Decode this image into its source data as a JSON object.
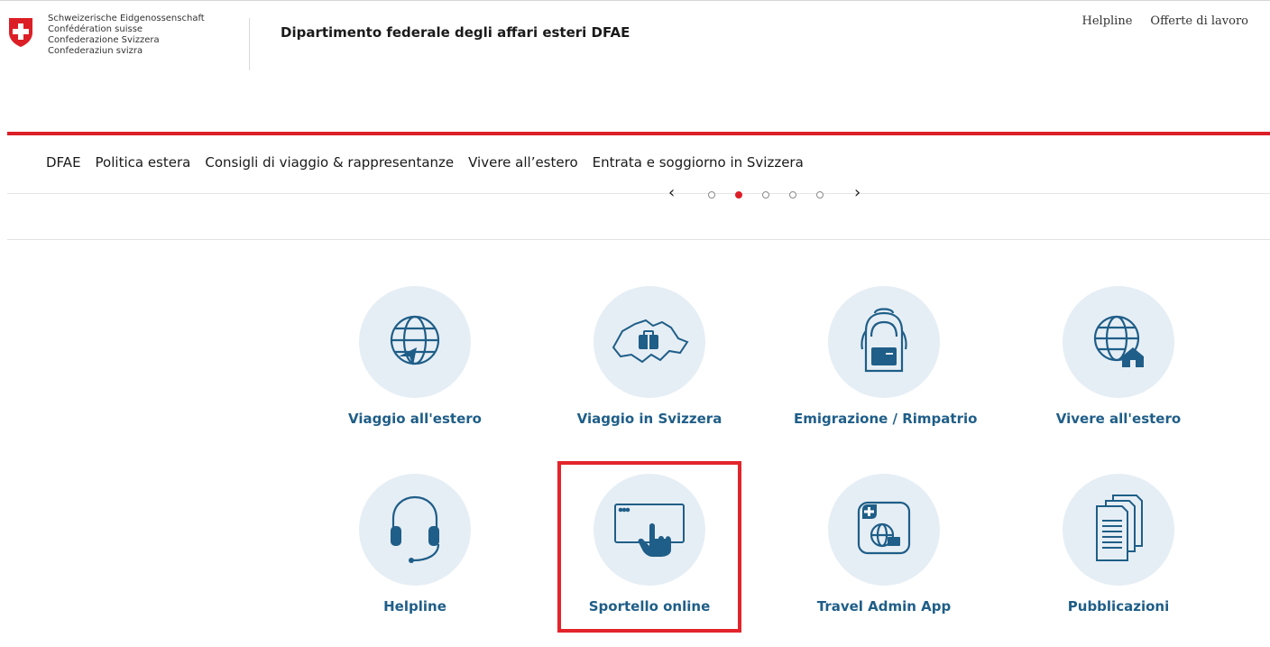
{
  "header": {
    "logo_lines": [
      "Schweizerische Eidgenossenschaft",
      "Confédération suisse",
      "Confederazione Svizzera",
      "Confederaziun svizra"
    ],
    "department": "Dipartimento federale degli affari esteri DFAE",
    "service_nav": [
      "Helpline",
      "Offerte di lavoro"
    ]
  },
  "main_nav": [
    "DFAE",
    "Politica estera",
    "Consigli di viaggio & rappresentanze",
    "Vivere all’estero",
    "Entrata e soggiorno in Svizzera"
  ],
  "carousel": {
    "active_index": 1,
    "dot_count": 5
  },
  "tiles": [
    {
      "label": "Viaggio all'estero",
      "icon": "globe-plane-icon"
    },
    {
      "label": "Viaggio in Svizzera",
      "icon": "switzerland-suitcase-icon"
    },
    {
      "label": "Emigrazione / Rimpatrio",
      "icon": "backpack-icon"
    },
    {
      "label": "Vivere all'estero",
      "icon": "globe-house-icon"
    },
    {
      "label": "Helpline",
      "icon": "headset-icon"
    },
    {
      "label": "Sportello online",
      "icon": "screen-touch-icon"
    },
    {
      "label": "Travel Admin App",
      "icon": "app-globe-bag-icon"
    },
    {
      "label": "Pubblicazioni",
      "icon": "documents-icon"
    }
  ],
  "colors": {
    "accent_red": "#dc1f26",
    "tile_label": "#1f5e88",
    "icon_blue": "#1f5e88",
    "circle_bg": "#e6eef5",
    "highlight": "#e3242b"
  }
}
